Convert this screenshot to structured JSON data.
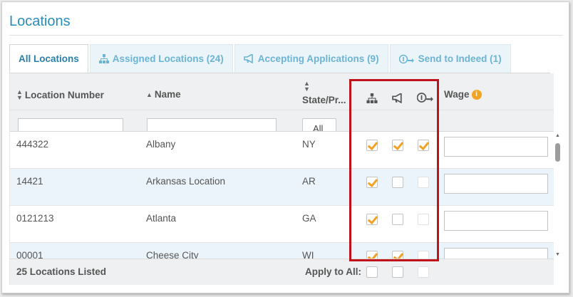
{
  "page": {
    "title": "Locations"
  },
  "tabs": [
    {
      "label": "All Locations",
      "icon": "none",
      "active": true
    },
    {
      "label": "Assigned Locations (24)",
      "icon": "hierarchy-icon",
      "active": false
    },
    {
      "label": "Accepting Applications (9)",
      "icon": "megaphone-icon",
      "active": false
    },
    {
      "label": "Send to Indeed  (1)",
      "icon": "indeed-send-icon",
      "active": false
    }
  ],
  "columns": {
    "location_number": "Location Number",
    "name": "Name",
    "state": "State/Pr...",
    "assigned_icon": "hierarchy-icon",
    "accepting_icon": "megaphone-icon",
    "indeed_icon": "indeed-send-icon",
    "wage": "Wage",
    "wage_info_icon": "info-icon"
  },
  "filters": {
    "state_button": "All",
    "location_number": "",
    "name": ""
  },
  "rows": [
    {
      "location_number": "444322",
      "name": "Albany",
      "state": "NY",
      "assigned": true,
      "accepting": true,
      "indeed": true,
      "indeed_enabled": true,
      "wage": ""
    },
    {
      "location_number": "14421",
      "name": "Arkansas Location",
      "state": "AR",
      "assigned": true,
      "accepting": false,
      "indeed": false,
      "indeed_enabled": false,
      "wage": ""
    },
    {
      "location_number": "0121213",
      "name": "Atlanta",
      "state": "GA",
      "assigned": true,
      "accepting": false,
      "indeed": false,
      "indeed_enabled": false,
      "wage": ""
    },
    {
      "location_number": "00001",
      "name": "Cheese City",
      "state": "WI",
      "assigned": true,
      "accepting": true,
      "indeed": false,
      "indeed_enabled": false,
      "wage": ""
    }
  ],
  "footer": {
    "count_label": "25 Locations Listed",
    "apply_label": "Apply to All:"
  },
  "colors": {
    "accent": "#2a8cb8",
    "checkmark": "#f0a225",
    "highlight": "#c0121a",
    "alt_row": "#ebf4fa"
  }
}
